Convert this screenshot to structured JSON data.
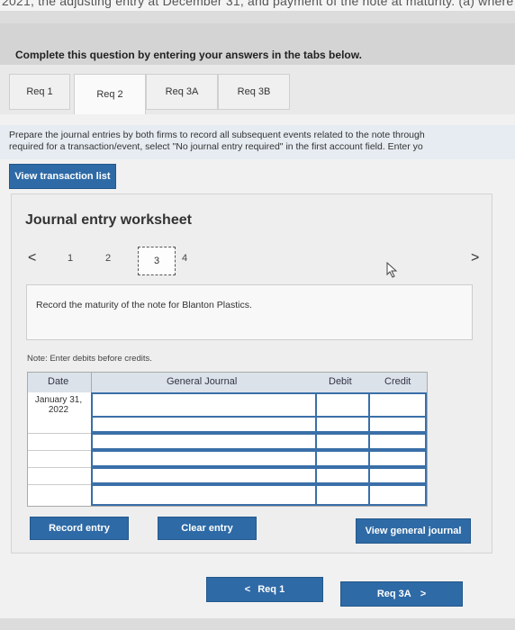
{
  "top_partial_text": "2021, the adjusting entry at December 31, and payment of the note at maturity. (a) where necessary.",
  "header": {
    "title": "Complete this question by entering your answers in the tabs below."
  },
  "tabs": [
    {
      "label": "Req 1",
      "active": false
    },
    {
      "label": "Req 2",
      "active": true
    },
    {
      "label": "Req 3A",
      "active": false
    },
    {
      "label": "Req 3B",
      "active": false
    }
  ],
  "instruction": {
    "line1": "Prepare the journal entries by both firms to record all subsequent events related to the note through",
    "line2": "required for a transaction/event, select \"No journal entry required\" in the first account field. Enter yo"
  },
  "view_transaction_label": "View transaction list",
  "worksheet": {
    "title": "Journal entry worksheet",
    "pages": [
      "1",
      "2",
      "3",
      "4"
    ],
    "active_page": "3",
    "description": "Record the maturity of the note for Blanton Plastics.",
    "note": "Note: Enter debits before credits.",
    "columns": {
      "date": "Date",
      "general_journal": "General Journal",
      "debit": "Debit",
      "credit": "Credit"
    },
    "date_value": "January 31, 2022"
  },
  "buttons": {
    "record_entry": "Record entry",
    "clear_entry": "Clear entry",
    "view_general_journal": "View general journal"
  },
  "nav": {
    "prev_label": "Req 1",
    "next_label": "Req 3A"
  },
  "colors": {
    "button_blue": "#2e6aa6",
    "header_blue": "#dbe2ea"
  }
}
